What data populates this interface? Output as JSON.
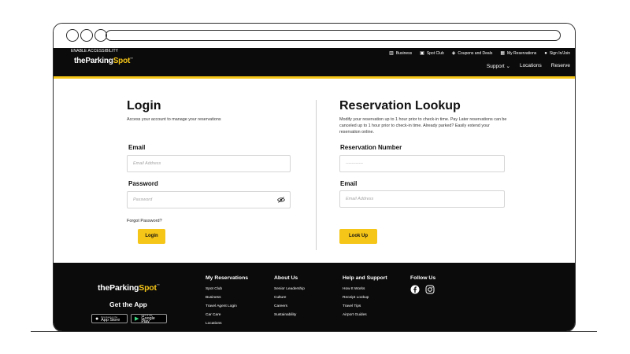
{
  "colors": {
    "brand_yellow": "#f5c518",
    "nav_black": "#0b0b0b"
  },
  "header": {
    "accessibility": "ENABLE ACCESSIBILITY",
    "logo": {
      "the": "the",
      "parking": "Parking",
      "spot": "Spot"
    },
    "utility_links": [
      {
        "icon": "building-icon",
        "label": "Business"
      },
      {
        "icon": "badge-icon",
        "label": "Spot Club"
      },
      {
        "icon": "tag-icon",
        "label": "Coupons and Deals"
      },
      {
        "icon": "calendar-icon",
        "label": "My Reservations"
      },
      {
        "icon": "user-icon",
        "label": "Sign In/Join"
      }
    ],
    "main_nav": [
      "Support ⌄",
      "Locations",
      "Reserve"
    ]
  },
  "login": {
    "title": "Login",
    "subtitle": "Access your account to manage your reservations",
    "email_label": "Email",
    "email_placeholder": "Email Address",
    "password_label": "Password",
    "password_placeholder": "Password",
    "forgot": "Forgot Password?",
    "button": "Login"
  },
  "lookup": {
    "title": "Reservation Lookup",
    "description": "Modify your reservation up to 1 hour prior to check-in time. Pay Later reservations can be canceled up to 1 hour prior to check-in time. Already parked? Easily extend your reservation online.",
    "number_label": "Reservation Number",
    "number_placeholder": "------------",
    "email_label": "Email",
    "email_placeholder": "Email Address",
    "button": "Look Up"
  },
  "footer": {
    "get_app": "Get the App",
    "app_store": {
      "small": "Download on the",
      "big": "App Store"
    },
    "google_play": {
      "small": "GET IT ON",
      "big": "Google Play"
    },
    "columns": [
      {
        "heading": "My Reservations",
        "links": [
          "Spot Club",
          "Business",
          "Travel Agent Login",
          "Car Care",
          "Locations"
        ]
      },
      {
        "heading": "About Us",
        "links": [
          "Senior Leadership",
          "Culture",
          "Careers",
          "Sustainability"
        ]
      },
      {
        "heading": "Help and Support",
        "links": [
          "How It Works",
          "Receipt Lookup",
          "Travel Tips",
          "Airport Guides"
        ]
      }
    ],
    "follow": "Follow Us",
    "social": [
      "facebook-icon",
      "instagram-icon"
    ]
  }
}
